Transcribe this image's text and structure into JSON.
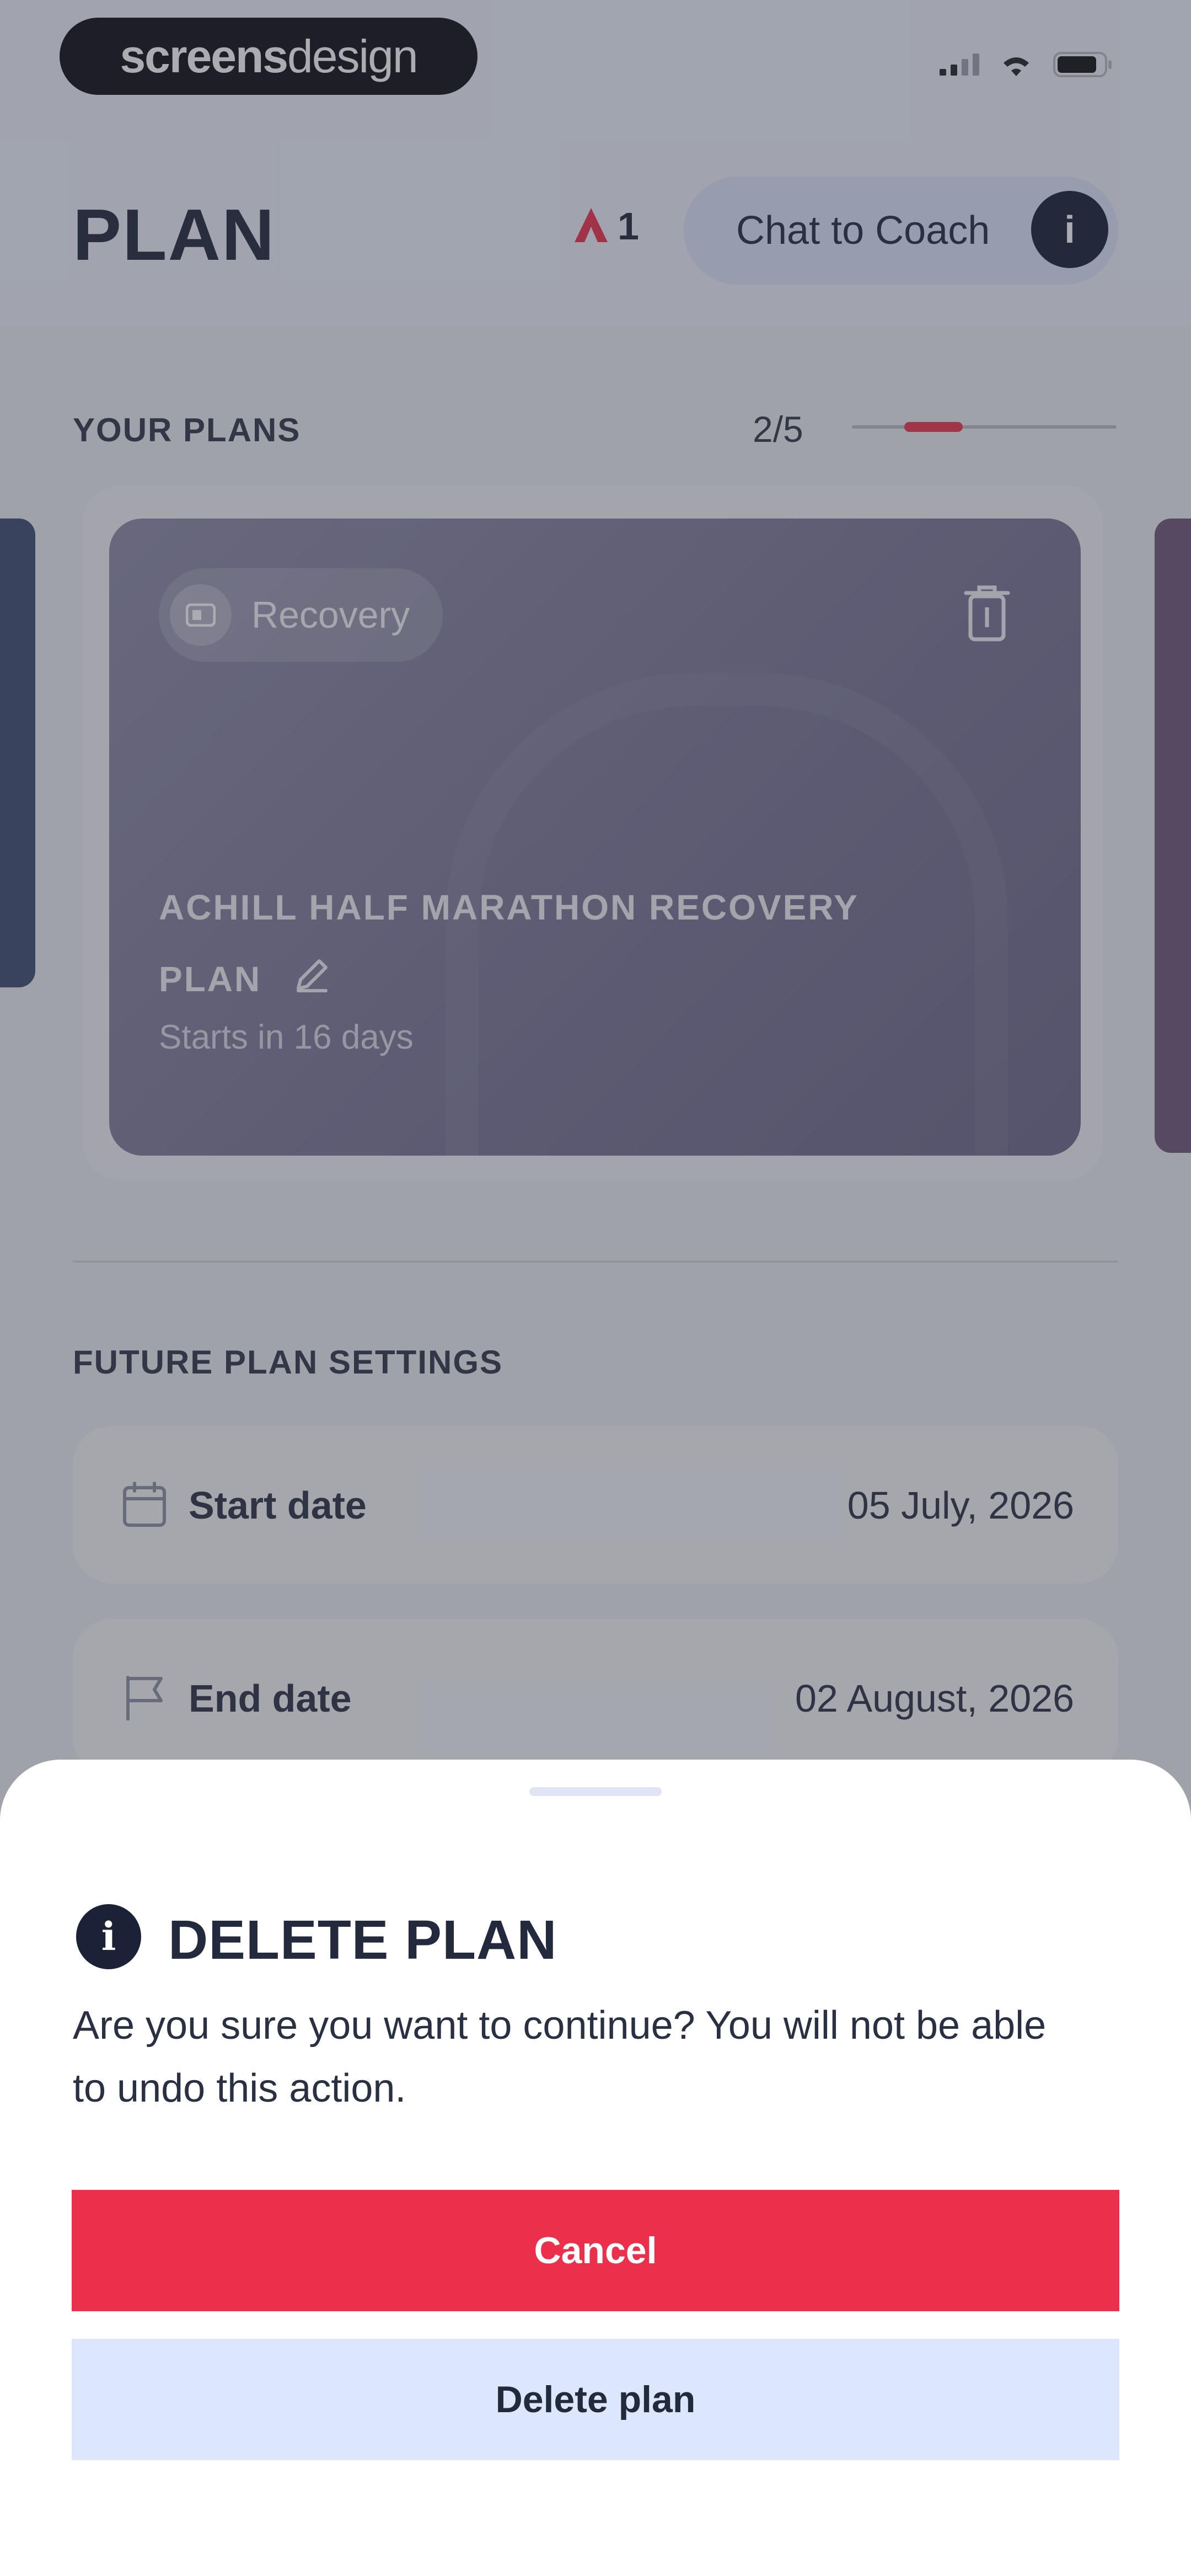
{
  "watermark": {
    "bold": "screens",
    "light": "design"
  },
  "header": {
    "title": "PLAN",
    "streak_count": "1",
    "coach_button_label": "Chat to Coach",
    "coach_badge": "i"
  },
  "plans": {
    "section_label": "YOUR PLANS",
    "pager": "2/5",
    "pager_current": 2,
    "pager_total": 5,
    "card": {
      "tag": "Recovery",
      "name_line1": "ACHILL HALF MARATHON RECOVERY",
      "name_line2": "PLAN",
      "subtitle": "Starts in 16 days"
    }
  },
  "settings": {
    "section_label": "FUTURE PLAN SETTINGS",
    "rows": [
      {
        "label": "Start date",
        "value": "05 July, 2026",
        "icon": "calendar-icon"
      },
      {
        "label": "End date",
        "value": "02 August, 2026",
        "icon": "flag-icon"
      }
    ]
  },
  "sheet": {
    "title": "DELETE PLAN",
    "body": "Are you sure you want to continue? You will not be able to undo this action.",
    "cancel_label": "Cancel",
    "delete_label": "Delete plan",
    "info_icon": "i"
  },
  "colors": {
    "accent_red": "#ec2f4b",
    "navy": "#1b2238",
    "light_blue": "#dce6fd",
    "card_purple": "#7a7595"
  }
}
